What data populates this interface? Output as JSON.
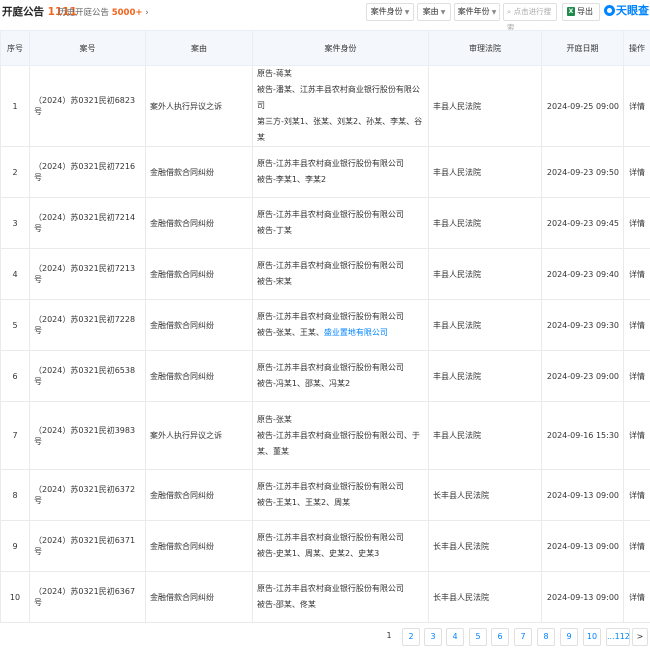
{
  "header": {
    "title": "开庭公告",
    "count": "1111",
    "history_label": "历史开庭公告",
    "history_count": "5000+",
    "history_arrow": "›",
    "filters": [
      "案件身份",
      "案由",
      "案件年份"
    ],
    "search_placeholder": "点击进行搜索",
    "export_label": "导出",
    "logo_text": "天眼查"
  },
  "table": {
    "columns": [
      "序号",
      "案号",
      "案由",
      "案件身份",
      "审理法院",
      "开庭日期",
      "操作"
    ],
    "rows": [
      {
        "no": "1",
        "case": "（2024）苏0321民初6823号",
        "reason": "案外人执行异议之诉",
        "parties": [
          "原告-蒋某",
          "被告-潘某、江苏丰县农村商业银行股份有限公司",
          "第三方-刘某1、张某、刘某2、孙某、李某、谷某"
        ],
        "court": "丰县人民法院",
        "date": "2024-09-25 09:00",
        "action": "详情"
      },
      {
        "no": "2",
        "case": "（2024）苏0321民初7216号",
        "reason": "金融借款合同纠纷",
        "parties": [
          "原告-江苏丰县农村商业银行股份有限公司",
          "被告-李某1、李某2"
        ],
        "court": "丰县人民法院",
        "date": "2024-09-23 09:50",
        "action": "详情"
      },
      {
        "no": "3",
        "case": "（2024）苏0321民初7214号",
        "reason": "金融借款合同纠纷",
        "parties": [
          "原告-江苏丰县农村商业银行股份有限公司",
          "被告-丁某"
        ],
        "court": "丰县人民法院",
        "date": "2024-09-23 09:45",
        "action": "详情"
      },
      {
        "no": "4",
        "case": "（2024）苏0321民初7213号",
        "reason": "金融借款合同纠纷",
        "parties": [
          "原告-江苏丰县农村商业银行股份有限公司",
          "被告-宋某"
        ],
        "court": "丰县人民法院",
        "date": "2024-09-23 09:40",
        "action": "详情"
      },
      {
        "no": "5",
        "case": "（2024）苏0321民初7228号",
        "reason": "金融借款合同纠纷",
        "parties": [
          "原告-江苏丰县农村商业银行股份有限公司",
          "被告-张某、王某、"
        ],
        "party_link": "盛业置地有限公司",
        "court": "丰县人民法院",
        "date": "2024-09-23 09:30",
        "action": "详情"
      },
      {
        "no": "6",
        "case": "（2024）苏0321民初6538号",
        "reason": "金融借款合同纠纷",
        "parties": [
          "原告-江苏丰县农村商业银行股份有限公司",
          "被告-冯某1、邵某、冯某2"
        ],
        "court": "丰县人民法院",
        "date": "2024-09-23 09:00",
        "action": "详情"
      },
      {
        "no": "7",
        "case": "（2024）苏0321民初3983号",
        "reason": "案外人执行异议之诉",
        "parties": [
          "原告-张某",
          "被告-江苏丰县农村商业银行股份有限公司、于",
          "某、董某"
        ],
        "court": "丰县人民法院",
        "date": "2024-09-16 15:30",
        "action": "详情"
      },
      {
        "no": "8",
        "case": "（2024）苏0321民初6372号",
        "reason": "金融借款合同纠纷",
        "parties": [
          "原告-江苏丰县农村商业银行股份有限公司",
          "被告-王某1、王某2、周某"
        ],
        "court": "长丰县人民法院",
        "date": "2024-09-13 09:00",
        "action": "详情"
      },
      {
        "no": "9",
        "case": "（2024）苏0321民初6371号",
        "reason": "金融借款合同纠纷",
        "parties": [
          "原告-江苏丰县农村商业银行股份有限公司",
          "被告-史某1、周某、史某2、史某3"
        ],
        "court": "长丰县人民法院",
        "date": "2024-09-13 09:00",
        "action": "详情"
      },
      {
        "no": "10",
        "case": "（2024）苏0321民初6367号",
        "reason": "金融借款合同纠纷",
        "parties": [
          "原告-江苏丰县农村商业银行股份有限公司",
          "被告-邵某、佟某"
        ],
        "court": "长丰县人民法院",
        "date": "2024-09-13 09:00",
        "action": "详情"
      }
    ]
  },
  "pagination": {
    "pages": [
      "1",
      "2",
      "3",
      "4",
      "5",
      "6",
      "7",
      "8",
      "9",
      "10",
      "...112",
      ">"
    ],
    "current": "1"
  }
}
